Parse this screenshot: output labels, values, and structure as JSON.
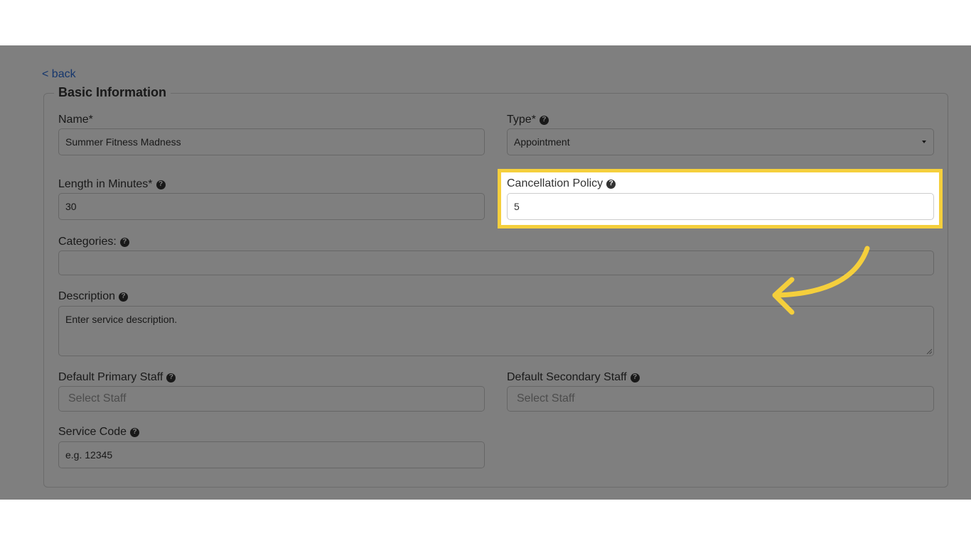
{
  "back_link": "< back",
  "section_title": "Basic Information",
  "fields": {
    "name": {
      "label": "Name*",
      "value": "Summer Fitness Madness"
    },
    "type": {
      "label": "Type*",
      "value": "Appointment"
    },
    "length": {
      "label": "Length in Minutes*",
      "value": "30"
    },
    "cancellation": {
      "label": "Cancellation Policy",
      "value": "5"
    },
    "categories": {
      "label": "Categories:",
      "value": ""
    },
    "description": {
      "label": "Description",
      "placeholder": "Enter service description."
    },
    "primary_staff": {
      "label": "Default Primary Staff",
      "placeholder": "Select Staff"
    },
    "secondary_staff": {
      "label": "Default Secondary Staff",
      "placeholder": "Select Staff"
    },
    "service_code": {
      "label": "Service Code",
      "placeholder": "e.g. 12345"
    }
  },
  "help_glyph": "?",
  "colors": {
    "highlight": "#f5cf3c",
    "link": "#2a6dd9",
    "overlay": "rgba(0,0,0,0.5)"
  },
  "icons": {
    "help": "question-circle-icon",
    "dropdown": "caret-down-icon",
    "pointer": "curved-arrow-icon"
  }
}
